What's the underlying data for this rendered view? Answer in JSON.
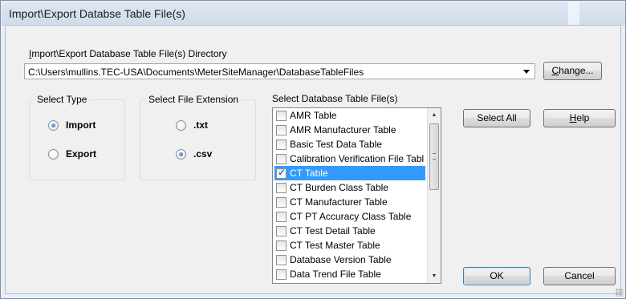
{
  "window": {
    "title": "Import\\Export Databse Table File(s)"
  },
  "directory": {
    "label_prefix": "I",
    "label_rest": "mport\\Export Database Table File(s) Directory",
    "path": "C:\\Users\\mullins.TEC-USA\\Documents\\MeterSiteManager\\DatabaseTableFiles",
    "change_button": {
      "mnemonic": "C",
      "rest": "hange..."
    }
  },
  "select_type": {
    "title": "Select Type",
    "options": [
      {
        "label": "Import",
        "selected": true
      },
      {
        "label": "Export",
        "selected": false
      }
    ]
  },
  "select_extension": {
    "title": "Select File Extension",
    "options": [
      {
        "label": ".txt",
        "selected": false
      },
      {
        "label": ".csv",
        "selected": true
      }
    ]
  },
  "table_files": {
    "label": "Select Database Table File(s)",
    "items": [
      {
        "label": "AMR Table",
        "checked": false,
        "selected": false
      },
      {
        "label": "AMR Manufacturer Table",
        "checked": false,
        "selected": false
      },
      {
        "label": "Basic Test Data Table",
        "checked": false,
        "selected": false
      },
      {
        "label": "Calibration Verification File Tabl",
        "checked": false,
        "selected": false
      },
      {
        "label": "CT Table",
        "checked": true,
        "selected": true
      },
      {
        "label": "CT Burden Class Table",
        "checked": false,
        "selected": false
      },
      {
        "label": "CT Manufacturer Table",
        "checked": false,
        "selected": false
      },
      {
        "label": "CT PT Accuracy Class Table",
        "checked": false,
        "selected": false
      },
      {
        "label": "CT Test Detail Table",
        "checked": false,
        "selected": false
      },
      {
        "label": "CT Test Master Table",
        "checked": false,
        "selected": false
      },
      {
        "label": "Database Version Table",
        "checked": false,
        "selected": false
      },
      {
        "label": "Data Trend File Table",
        "checked": false,
        "selected": false
      }
    ]
  },
  "buttons": {
    "select_all": "Select All",
    "help": {
      "mnemonic": "H",
      "rest": "elp"
    },
    "ok": "OK",
    "cancel": "Cancel"
  }
}
